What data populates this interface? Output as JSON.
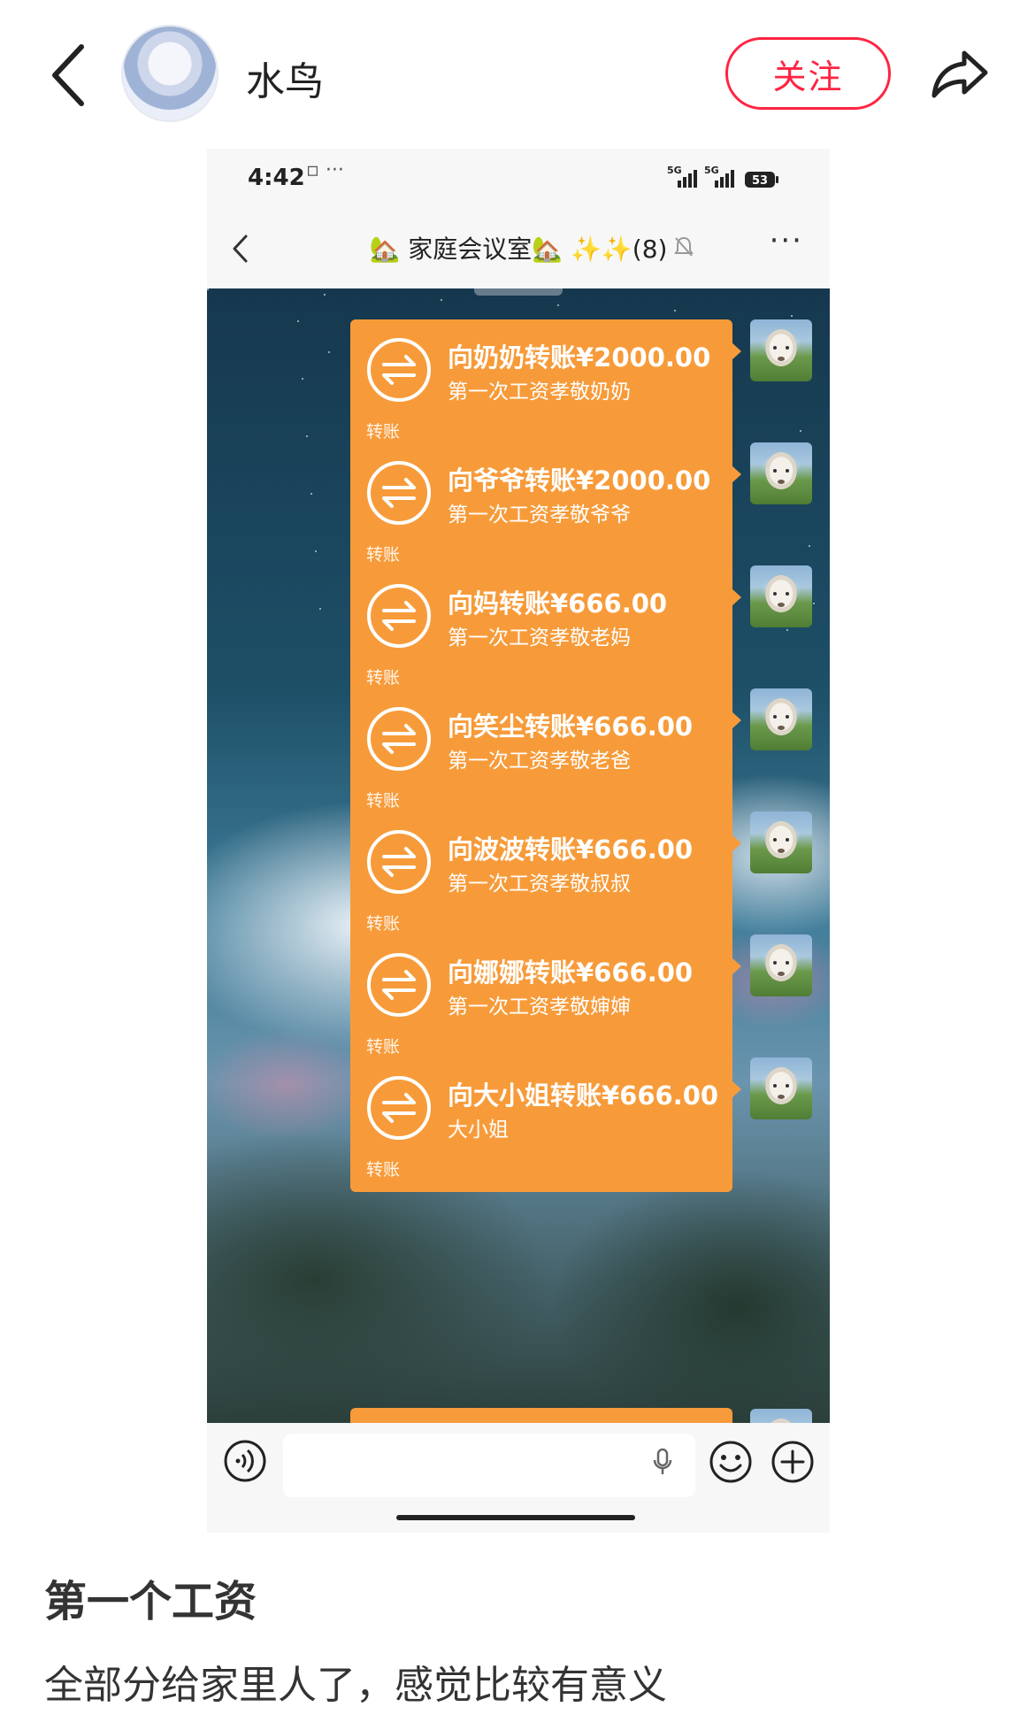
{
  "header": {
    "back_icon": "chevron-left-icon",
    "username": "水鸟",
    "follow_label": "关注",
    "share_icon": "share-icon",
    "accent": "#ff2442"
  },
  "screenshot": {
    "status": {
      "time": "4:42",
      "dots": "▫ ···",
      "network": "5G 5G",
      "battery": "53"
    },
    "chat": {
      "title": "🏡 家庭会议室🏡 ✨✨(8)",
      "back_icon": "chevron-left-icon",
      "mute_icon": "bell-off-icon",
      "more_label": "···"
    },
    "bubble_color": "#f79b3a",
    "messages": [
      {
        "title": "向奶奶转账¥2000.00",
        "note": "第一次工资孝敬奶奶",
        "tag": "转账"
      },
      {
        "title": "向爷爷转账¥2000.00",
        "note": "第一次工资孝敬爷爷",
        "tag": "转账"
      },
      {
        "title": "向妈转账¥666.00",
        "note": "第一次工资孝敬老妈",
        "tag": "转账"
      },
      {
        "title": "向笑尘转账¥666.00",
        "note": "第一次工资孝敬老爸",
        "tag": "转账"
      },
      {
        "title": "向波波转账¥666.00",
        "note": "第一次工资孝敬叔叔",
        "tag": "转账"
      },
      {
        "title": "向娜娜转账¥666.00",
        "note": "第一次工资孝敬婶婶",
        "tag": "转账"
      },
      {
        "title": "向大小姐转账¥666.00",
        "note": "大小姐",
        "tag": "转账"
      }
    ],
    "input": {
      "value": "",
      "placeholder": ""
    }
  },
  "post": {
    "title": "第一个工资",
    "body": "全部分给家里人了，感觉比较有意义"
  }
}
